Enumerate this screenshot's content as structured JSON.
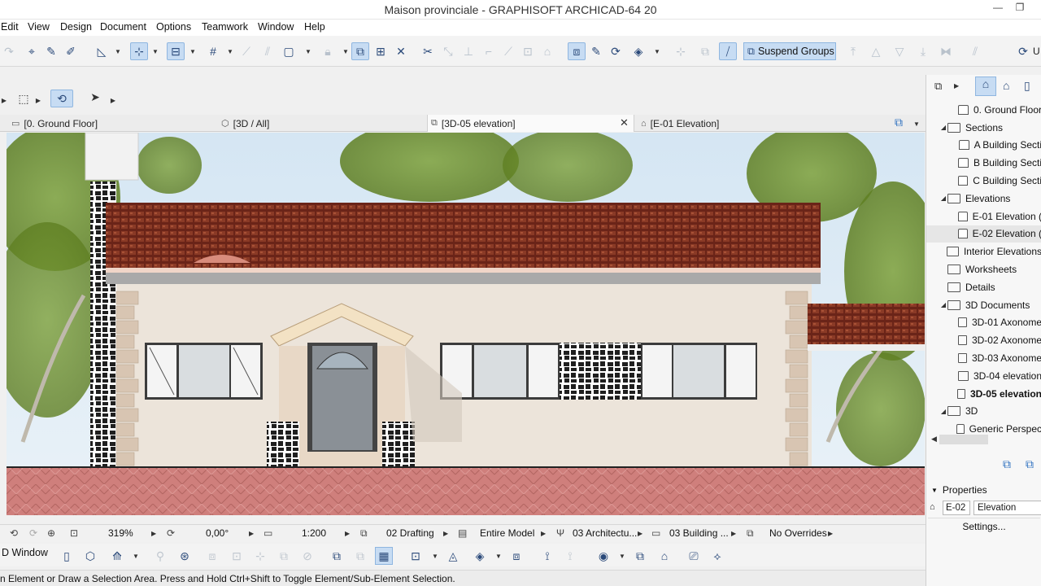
{
  "window": {
    "title": "Maison provinciale - GRAPHISOFT ARCHICAD-64 20",
    "minimize": "—",
    "restore": "❐"
  },
  "menu": [
    "Edit",
    "View",
    "Design",
    "Document",
    "Options",
    "Teamwork",
    "Window",
    "Help"
  ],
  "toolbar": {
    "suspend_groups": "Suspend Groups",
    "overflow": "U"
  },
  "tabs": [
    {
      "label": "[0. Ground Floor]",
      "icon": "floor-plan-icon"
    },
    {
      "label": "[3D / All]",
      "icon": "3d-box-icon"
    },
    {
      "label": "[3D-05 elevation]",
      "icon": "3d-document-icon",
      "active": true
    },
    {
      "label": "[E-01 Elevation]",
      "icon": "elevation-icon"
    }
  ],
  "statusbar": {
    "zoom": "319%",
    "angle": "0,00°",
    "scale": "1:200",
    "layer_combination": "02 Drafting",
    "model_filter": "Entire Model",
    "pen_set": "03 Architectu...",
    "mvo": "03 Building ...",
    "overrides": "No Overrides"
  },
  "bottombar": {
    "window_label": "D Window"
  },
  "hint": "n Element or Draw a Selection Area. Press and Hold Ctrl+Shift to Toggle Element/Sub-Element Selection.",
  "navigator": {
    "items": [
      {
        "label": "0. Ground Floor",
        "indent": 2,
        "toggle": "",
        "icon": "house"
      },
      {
        "label": "Sections",
        "indent": 1,
        "toggle": "◢",
        "icon": "folder"
      },
      {
        "label": "A Building Secti",
        "indent": 2,
        "toggle": "",
        "icon": "house"
      },
      {
        "label": "B Building Secti",
        "indent": 2,
        "toggle": "",
        "icon": "house"
      },
      {
        "label": "C Building Secti",
        "indent": 2,
        "toggle": "",
        "icon": "house"
      },
      {
        "label": "Elevations",
        "indent": 1,
        "toggle": "◢",
        "icon": "folder"
      },
      {
        "label": "E-01 Elevation (",
        "indent": 2,
        "toggle": "",
        "icon": "house"
      },
      {
        "label": "E-02 Elevation (",
        "indent": 2,
        "toggle": "",
        "icon": "house",
        "selected": true
      },
      {
        "label": "Interior Elevations",
        "indent": 1,
        "toggle": "",
        "icon": "folder"
      },
      {
        "label": "Worksheets",
        "indent": 1,
        "toggle": "",
        "icon": "folder"
      },
      {
        "label": "Details",
        "indent": 1,
        "toggle": "",
        "icon": "folder"
      },
      {
        "label": "3D Documents",
        "indent": 1,
        "toggle": "◢",
        "icon": "folder"
      },
      {
        "label": "3D-01 Axonome",
        "indent": 2,
        "toggle": "",
        "icon": "folder"
      },
      {
        "label": "3D-02 Axonome",
        "indent": 2,
        "toggle": "",
        "icon": "folder"
      },
      {
        "label": "3D-03 Axonome",
        "indent": 2,
        "toggle": "",
        "icon": "folder"
      },
      {
        "label": "3D-04 elevation",
        "indent": 2,
        "toggle": "",
        "icon": "folder"
      },
      {
        "label": "3D-05 elevation",
        "indent": 2,
        "toggle": "",
        "icon": "folder",
        "bold": true
      },
      {
        "label": "3D",
        "indent": 1,
        "toggle": "◢",
        "icon": "folder"
      },
      {
        "label": "Generic Perspec",
        "indent": 2,
        "toggle": "",
        "icon": "house"
      }
    ],
    "properties_label": "Properties",
    "props_id": "E-02",
    "props_name": "Elevation",
    "settings_label": "Settings..."
  }
}
